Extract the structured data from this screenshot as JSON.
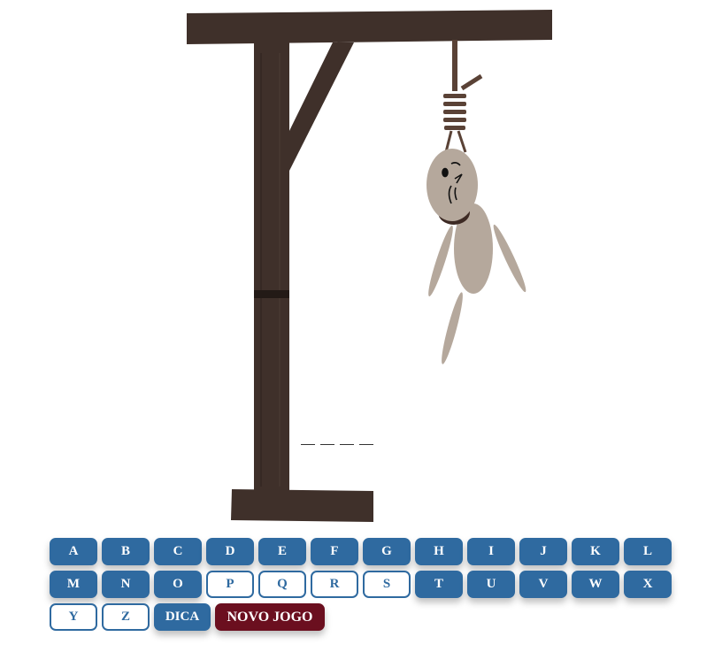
{
  "word": {
    "blank_count": 4,
    "revealed": [
      "",
      "",
      "",
      ""
    ]
  },
  "keyboard": {
    "rows": [
      [
        {
          "letter": "A",
          "used": false
        },
        {
          "letter": "B",
          "used": false
        },
        {
          "letter": "C",
          "used": false
        },
        {
          "letter": "D",
          "used": false
        },
        {
          "letter": "E",
          "used": false
        },
        {
          "letter": "F",
          "used": false
        },
        {
          "letter": "G",
          "used": false
        },
        {
          "letter": "H",
          "used": false
        },
        {
          "letter": "I",
          "used": false
        },
        {
          "letter": "J",
          "used": false
        },
        {
          "letter": "K",
          "used": false
        },
        {
          "letter": "L",
          "used": false
        }
      ],
      [
        {
          "letter": "M",
          "used": false
        },
        {
          "letter": "N",
          "used": false
        },
        {
          "letter": "O",
          "used": false
        },
        {
          "letter": "P",
          "used": true
        },
        {
          "letter": "Q",
          "used": true
        },
        {
          "letter": "R",
          "used": true
        },
        {
          "letter": "S",
          "used": true
        },
        {
          "letter": "T",
          "used": false
        },
        {
          "letter": "U",
          "used": false
        },
        {
          "letter": "V",
          "used": false
        },
        {
          "letter": "W",
          "used": false
        },
        {
          "letter": "X",
          "used": false
        }
      ],
      [
        {
          "letter": "Y",
          "used": true
        },
        {
          "letter": "Z",
          "used": true
        }
      ]
    ],
    "hint_label": "DICA",
    "new_game_label": "NOVO JOGO"
  },
  "colors": {
    "key_blue": "#2f6aa0",
    "new_game_red": "#6b0f1f",
    "wood": "#3f302a",
    "figure": "#b5a89c"
  }
}
